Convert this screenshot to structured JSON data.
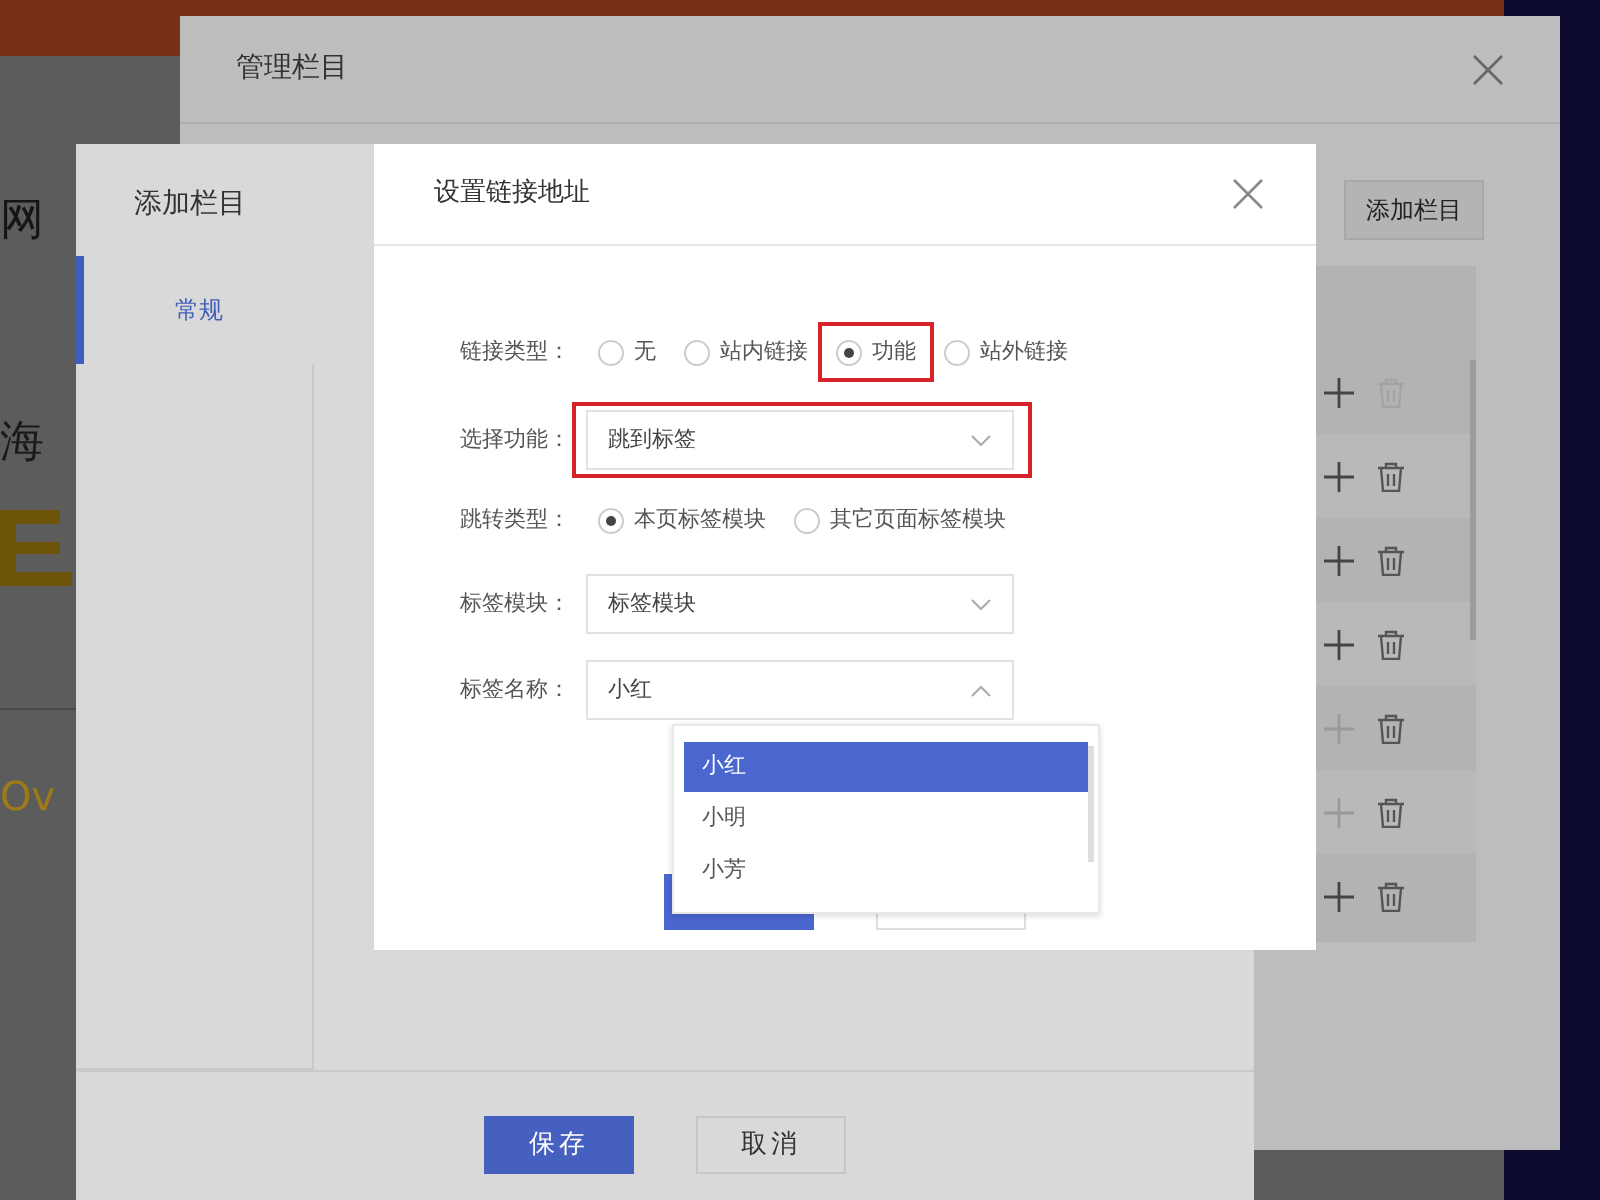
{
  "background_page": {
    "texts": [
      "网",
      "海",
      "Ov"
    ]
  },
  "manage_dialog": {
    "title": "管理栏目",
    "add_button": "添加栏目",
    "rows": [
      {
        "add_disabled": false,
        "delete_disabled": true
      },
      {
        "add_disabled": false,
        "delete_disabled": false
      },
      {
        "add_disabled": false,
        "delete_disabled": false
      },
      {
        "add_disabled": false,
        "delete_disabled": false
      },
      {
        "add_disabled": true,
        "delete_disabled": false
      },
      {
        "add_disabled": true,
        "delete_disabled": false
      },
      {
        "add_disabled": false,
        "delete_disabled": false
      }
    ]
  },
  "add_dialog": {
    "title": "添加栏目",
    "tabs": [
      {
        "label": "常规",
        "selected": true
      }
    ],
    "buttons": [
      {
        "label": "保存",
        "kind": "primary"
      },
      {
        "label": "取消",
        "kind": "secondary"
      }
    ]
  },
  "link_dialog": {
    "title": "设置链接地址",
    "fields": [
      {
        "kind": "radio",
        "label": "链接类型：",
        "options": [
          {
            "label": "无",
            "selected": false,
            "highlighted": false
          },
          {
            "label": "站内链接",
            "selected": false,
            "highlighted": false
          },
          {
            "label": "功能",
            "selected": true,
            "highlighted": true
          },
          {
            "label": "站外链接",
            "selected": false,
            "highlighted": false
          }
        ]
      },
      {
        "kind": "select",
        "label": "选择功能：",
        "value": "跳到标签",
        "expanded": false,
        "highlighted": true
      },
      {
        "kind": "radio",
        "label": "跳转类型：",
        "options": [
          {
            "label": "本页标签模块",
            "selected": true,
            "highlighted": false
          },
          {
            "label": "其它页面标签模块",
            "selected": false,
            "highlighted": false
          }
        ]
      },
      {
        "kind": "select",
        "label": "标签模块：",
        "value": "标签模块",
        "expanded": false,
        "highlighted": false
      },
      {
        "kind": "select",
        "label": "标签名称：",
        "value": "小红",
        "expanded": true,
        "highlighted": false
      }
    ],
    "dropdown": {
      "options": [
        {
          "label": "小红",
          "selected": true
        },
        {
          "label": "小明",
          "selected": false
        },
        {
          "label": "小芳",
          "selected": false
        }
      ]
    }
  }
}
